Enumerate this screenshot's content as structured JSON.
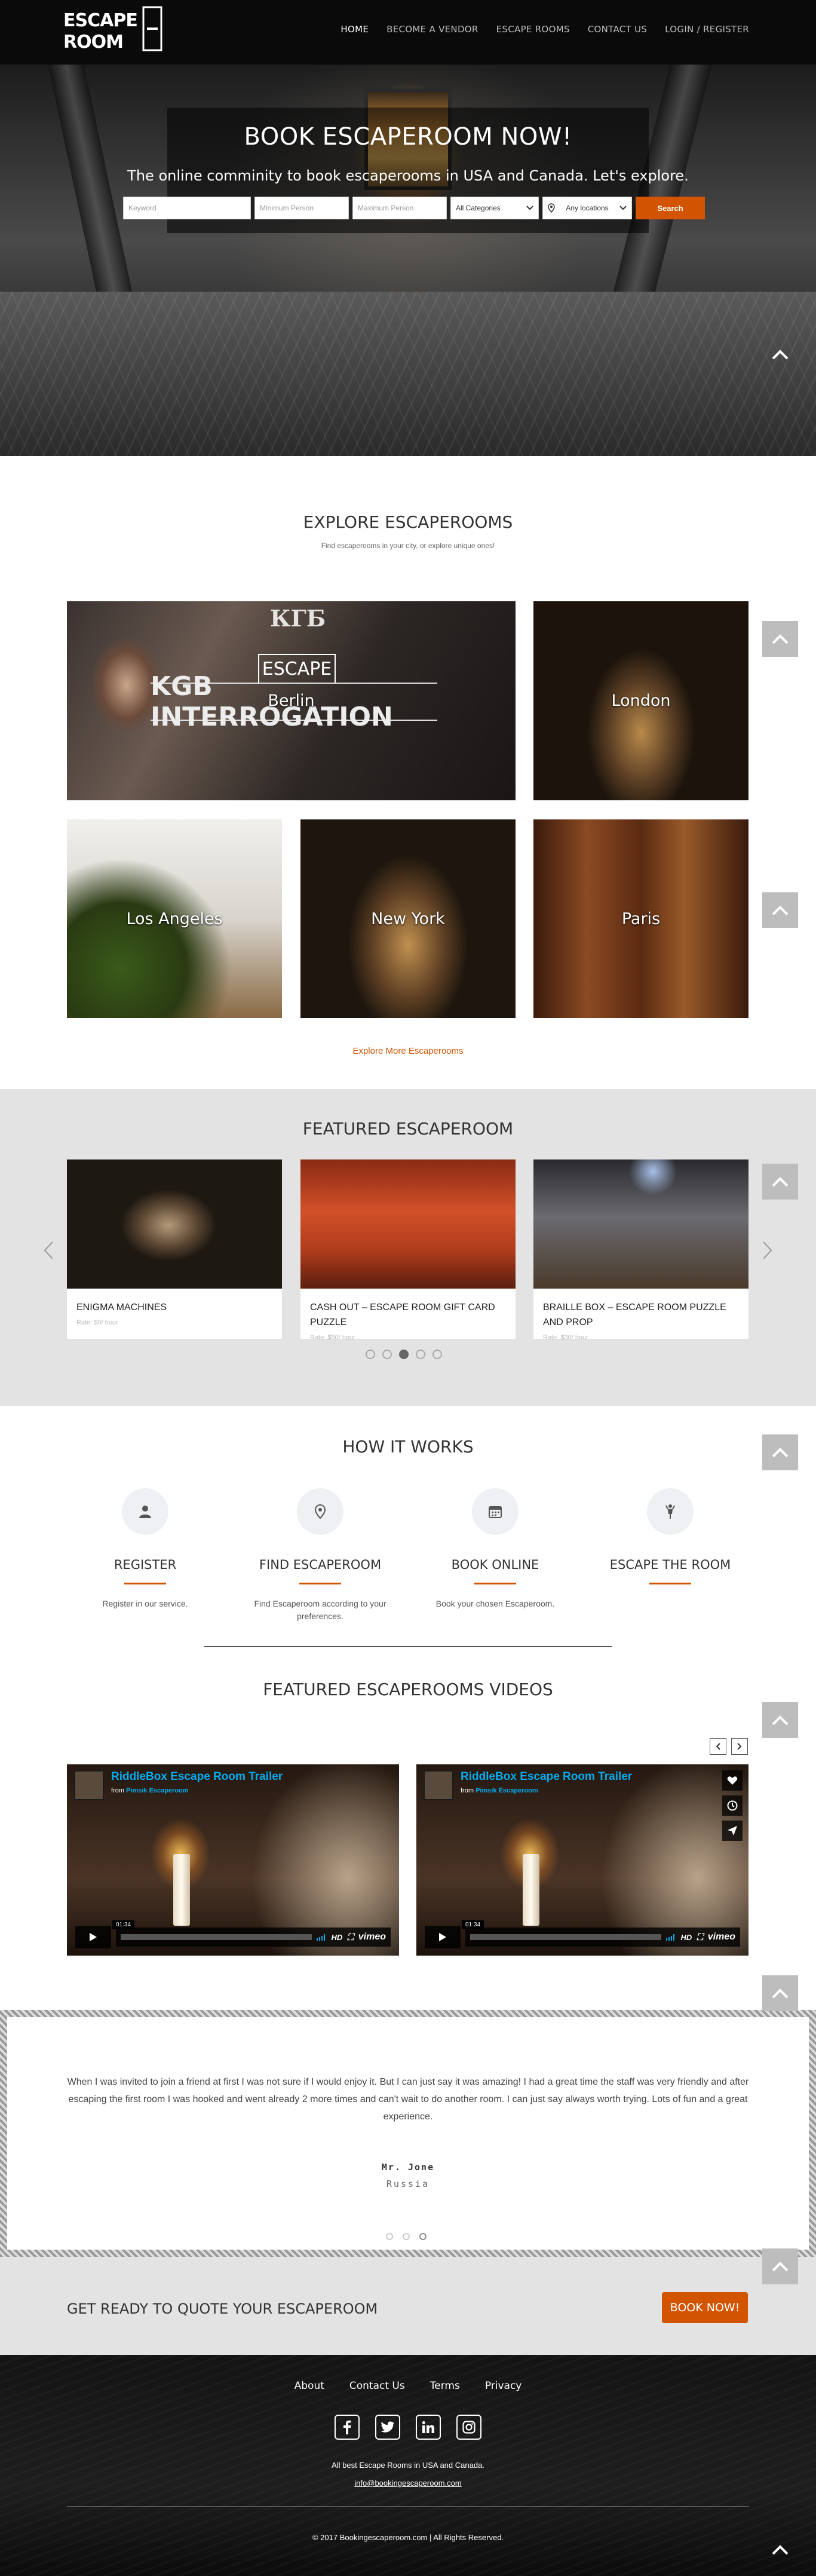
{
  "header": {
    "logo_text": "ESCAPE ROOM",
    "nav": [
      "HOME",
      "BECOME A VENDOR",
      "ESCAPE ROOMS",
      "CONTACT US",
      "LOGIN / REGISTER"
    ]
  },
  "hero": {
    "title": "BOOK ESCAPEROOM NOW!",
    "subtitle": "The online comminity to book escaperooms in USA and Canada. Let's explore.",
    "search": {
      "keyword_placeholder": "Keyword",
      "min_person_placeholder": "Minimum Person",
      "max_person_placeholder": "Maximum Person",
      "category_value": "All Categories",
      "location_value": "Any locations",
      "button": "Search"
    }
  },
  "explore": {
    "title": "EXPLORE ESCAPEROOMS",
    "subtitle": "Find escaperooms in your city, or explore unique ones!",
    "tiles": [
      {
        "label": "Berlin",
        "banner": "KGB INTERROGATION",
        "sign": "ESCAPE",
        "sign_top": "КГБ"
      },
      {
        "label": "London"
      },
      {
        "label": "Los Angeles"
      },
      {
        "label": "New York"
      },
      {
        "label": "Paris"
      }
    ],
    "more_link": "Explore More Escaperooms"
  },
  "featured": {
    "title": "FEATURED ESCAPEROOM",
    "cards": [
      {
        "title": "ENIGMA MACHINES",
        "rate": "Rate: $0/ hour"
      },
      {
        "title": "CASH OUT – ESCAPE ROOM GIFT CARD PUZZLE",
        "rate": "Rate: $50/ hour"
      },
      {
        "title": "BRAILLE BOX – ESCAPE ROOM PUZZLE AND PROP",
        "rate": "Rate: $30/ hour"
      }
    ]
  },
  "how": {
    "title": "HOW IT WORKS",
    "steps": [
      {
        "name": "REGISTER",
        "desc": "Register in our service.",
        "icon": "user-icon"
      },
      {
        "name": "FIND ESCAPEROOM",
        "desc": "Find Escaperoom according to your preferences.",
        "icon": "map-pin-icon"
      },
      {
        "name": "BOOK ONLINE",
        "desc": "Book your chosen Escaperoom.",
        "icon": "calendar-icon"
      },
      {
        "name": "ESCAPE THE ROOM",
        "desc": "",
        "icon": "person-icon"
      }
    ]
  },
  "videos": {
    "title": "FEATURED ESCAPEROOMS VIDEOS",
    "items": [
      {
        "title": "RiddleBox Escape Room Trailer",
        "from_label": "from",
        "from": "Pimsik Escaperoom",
        "time": "01:34",
        "hd": "HD",
        "brand": "vimeo"
      },
      {
        "title": "RiddleBox Escape Room Trailer",
        "from_label": "from",
        "from": "Pimsik Escaperoom",
        "time": "01:34",
        "hd": "HD",
        "brand": "vimeo"
      }
    ]
  },
  "testimonial": {
    "quote": "When I was invited to join a friend at first I was not sure if I would enjoy it. But I can just say it was amazing! I had a great time the staff was very friendly and after escaping the first room I was hooked and went already 2 more times and can't wait to do another room. I can just say always worth trying. Lots of fun and a great experience.",
    "author": "Mr. Jone",
    "country": "Russia"
  },
  "cta": {
    "text": "GET READY TO QUOTE YOUR ESCAPEROOM",
    "button": "BOOK NOW!"
  },
  "footer": {
    "links": [
      "About",
      "Contact Us",
      "Terms",
      "Privacy"
    ],
    "social": [
      "f",
      "t",
      "in",
      "ig"
    ],
    "tagline": "All best Escape Rooms in USA and Canada.",
    "email": "info@bookingescaperoom.com",
    "copyright": "© 2017 Bookingescaperoom.com | All Rights Reserved."
  },
  "colors": {
    "accent": "#d35400",
    "header_bg": "#0a0a0a",
    "featured_bg": "#e3e3e3",
    "vimeo_blue": "#00adef"
  }
}
